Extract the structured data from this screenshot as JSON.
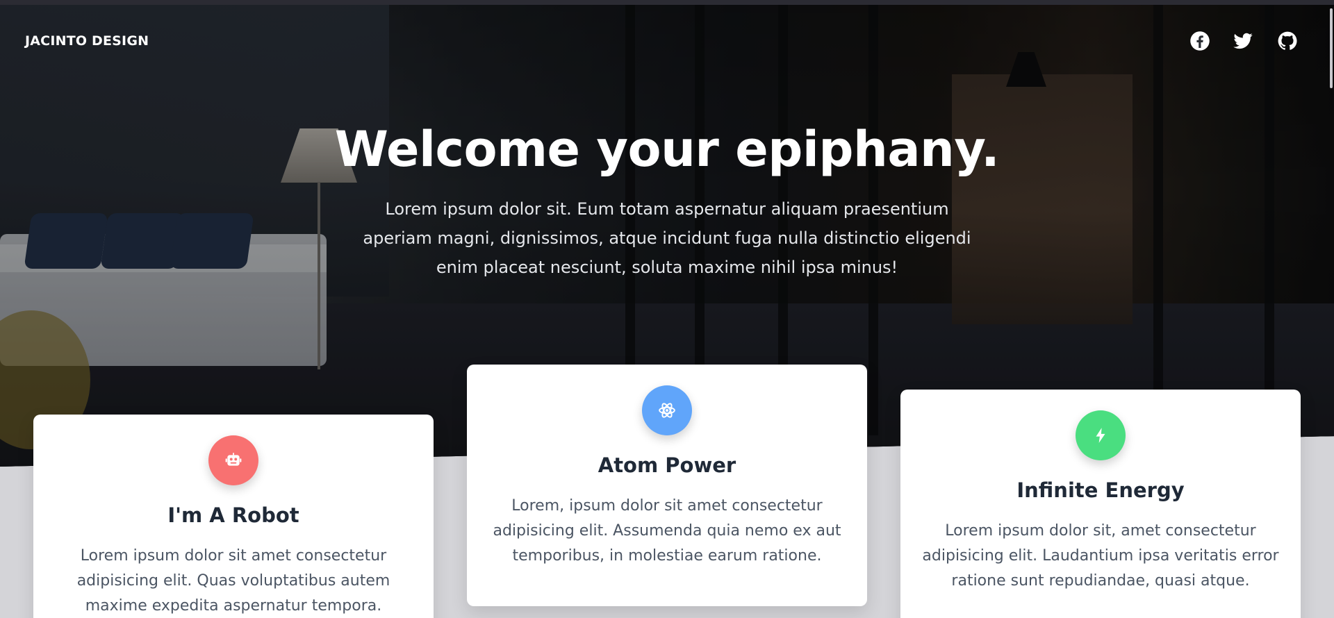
{
  "brand": "JACINTO DESIGN",
  "social": [
    {
      "icon": "facebook-icon"
    },
    {
      "icon": "twitter-icon"
    },
    {
      "icon": "github-icon"
    }
  ],
  "hero": {
    "title": "Welcome your epiphany.",
    "text": "Lorem ipsum dolor sit. Eum totam aspernatur aliquam praesentium aperiam magni, dignissimos, atque incidunt fuga nulla distinctio eligendi enim placeat nesciunt, soluta maxime nihil ipsa minus!"
  },
  "cards": [
    {
      "title": "I'm A Robot",
      "text": "Lorem ipsum dolor sit amet consectetur adipisicing elit. Quas voluptatibus autem maxime expedita aspernatur tempora.",
      "icon": "robot-icon",
      "color": "#f87171"
    },
    {
      "title": "Atom Power",
      "text": "Lorem, ipsum dolor sit amet consectetur adipisicing elit. Assumenda quia nemo ex aut temporibus, in molestiae earum ratione.",
      "icon": "atom-icon",
      "color": "#60a5fa"
    },
    {
      "title": "Infinite Energy",
      "text": "Lorem ipsum dolor sit, amet consectetur adipisicing elit. Laudantium ipsa veritatis error ratione sunt repudiandae, quasi atque.",
      "icon": "bolt-icon",
      "color": "#4ade80"
    }
  ]
}
